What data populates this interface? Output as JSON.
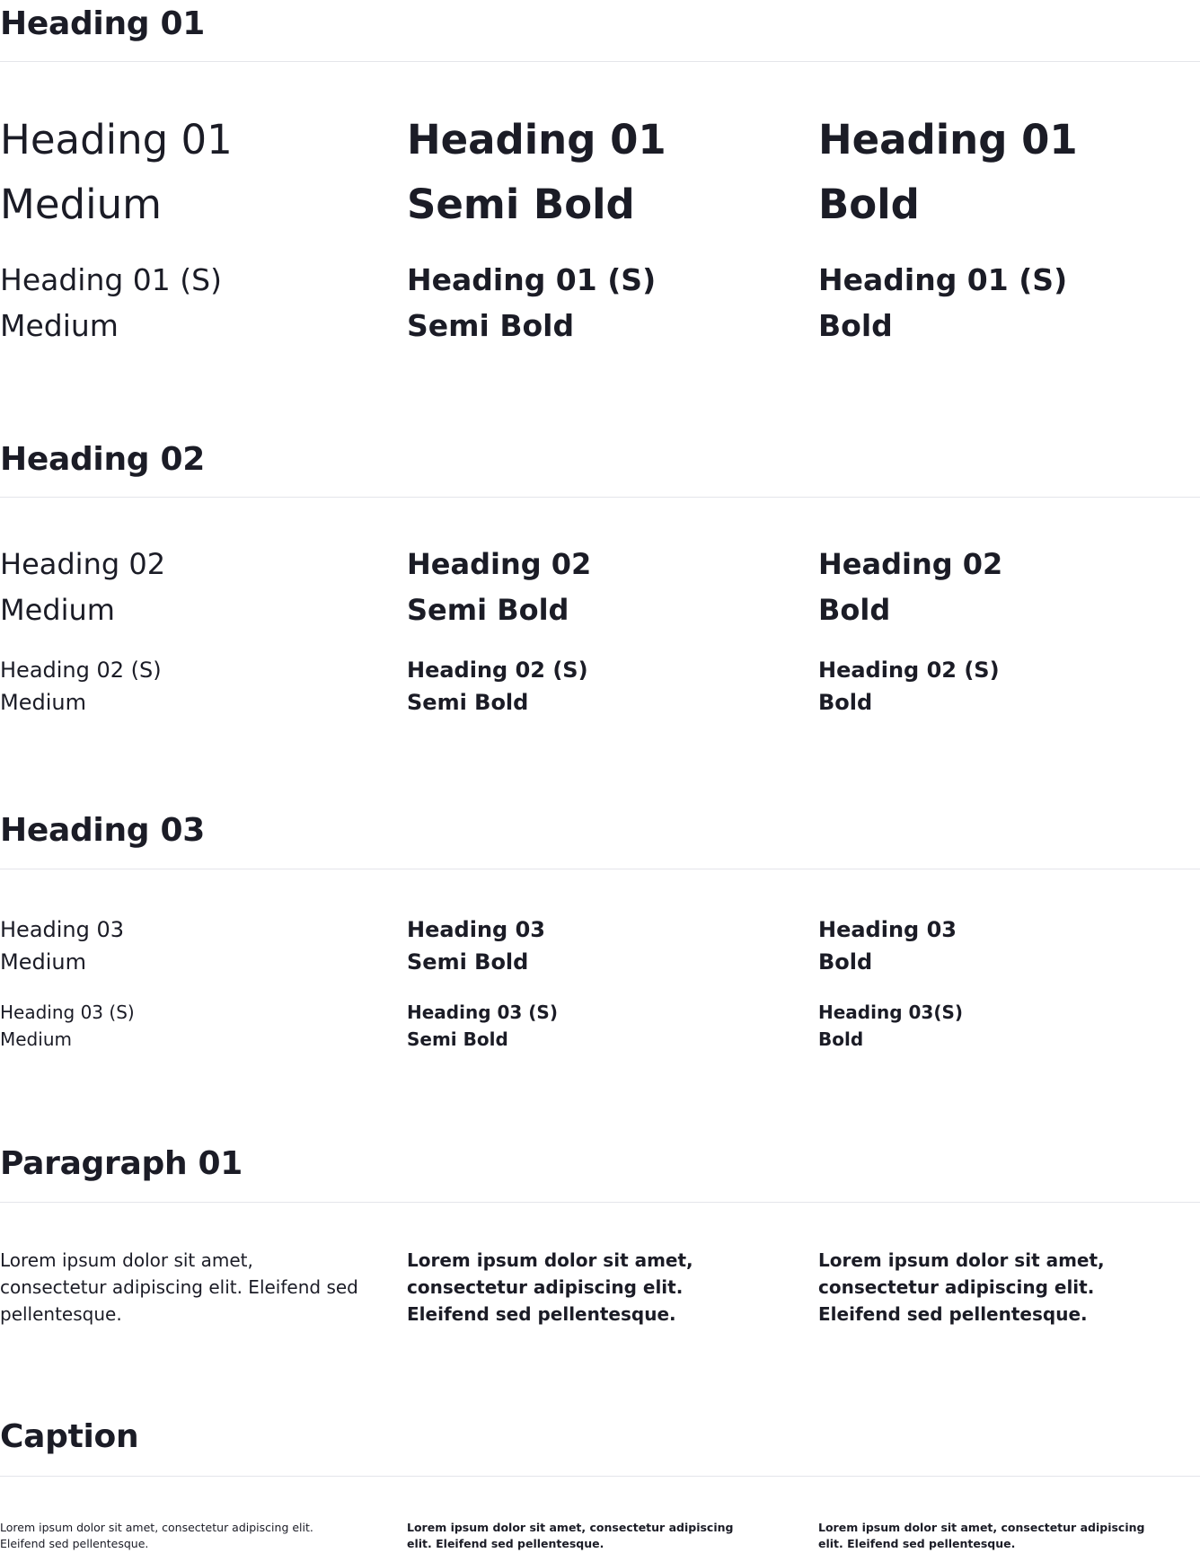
{
  "sections": {
    "heading01": {
      "title": "Heading 01",
      "large": [
        {
          "line1": "Heading 01",
          "line2": "Medium"
        },
        {
          "line1": "Heading 01",
          "line2": "Semi Bold"
        },
        {
          "line1": "Heading 01",
          "line2": "Bold"
        }
      ],
      "small": [
        {
          "line1": "Heading 01 (S)",
          "line2": "Medium"
        },
        {
          "line1": "Heading 01 (S)",
          "line2": "Semi Bold"
        },
        {
          "line1": "Heading 01 (S)",
          "line2": "Bold"
        }
      ]
    },
    "heading02": {
      "title": "Heading 02",
      "large": [
        {
          "line1": "Heading 02",
          "line2": "Medium"
        },
        {
          "line1": "Heading 02",
          "line2": "Semi Bold"
        },
        {
          "line1": "Heading 02",
          "line2": "Bold"
        }
      ],
      "small": [
        {
          "line1": "Heading 02 (S)",
          "line2": "Medium"
        },
        {
          "line1": "Heading 02 (S)",
          "line2": "Semi Bold"
        },
        {
          "line1": "Heading 02 (S)",
          "line2": "Bold"
        }
      ]
    },
    "heading03": {
      "title": "Heading 03",
      "large": [
        {
          "line1": "Heading 03",
          "line2": "Medium"
        },
        {
          "line1": "Heading 03",
          "line2": "Semi Bold"
        },
        {
          "line1": "Heading 03",
          "line2": "Bold"
        }
      ],
      "small": [
        {
          "line1": "Heading 03 (S)",
          "line2": "Medium"
        },
        {
          "line1": "Heading 03 (S)",
          "line2": "Semi Bold"
        },
        {
          "line1": "Heading 03(S)",
          "line2": "Bold"
        }
      ]
    },
    "paragraph01": {
      "title": "Paragraph 01",
      "texts": [
        "Lorem ipsum dolor sit amet, consectetur adipiscing elit. Eleifend sed pellentesque.",
        "Lorem ipsum dolor sit amet, consectetur adipiscing elit. Eleifend sed pellentesque.",
        "Lorem ipsum dolor sit amet, consectetur adipiscing elit. Eleifend sed pellentesque."
      ]
    },
    "caption": {
      "title": "Caption",
      "texts": [
        "Lorem ipsum dolor sit amet, consectetur adipiscing elit. Eleifend sed pellentesque.",
        "Lorem ipsum dolor sit amet, consectetur adipiscing elit. Eleifend sed pellentesque.",
        "Lorem ipsum dolor sit amet, consectetur adipiscing elit. Eleifend sed pellentesque."
      ]
    }
  },
  "colors": {
    "text": "#1b1c26",
    "rule": "#e4e5ea",
    "background": "#ffffff"
  }
}
